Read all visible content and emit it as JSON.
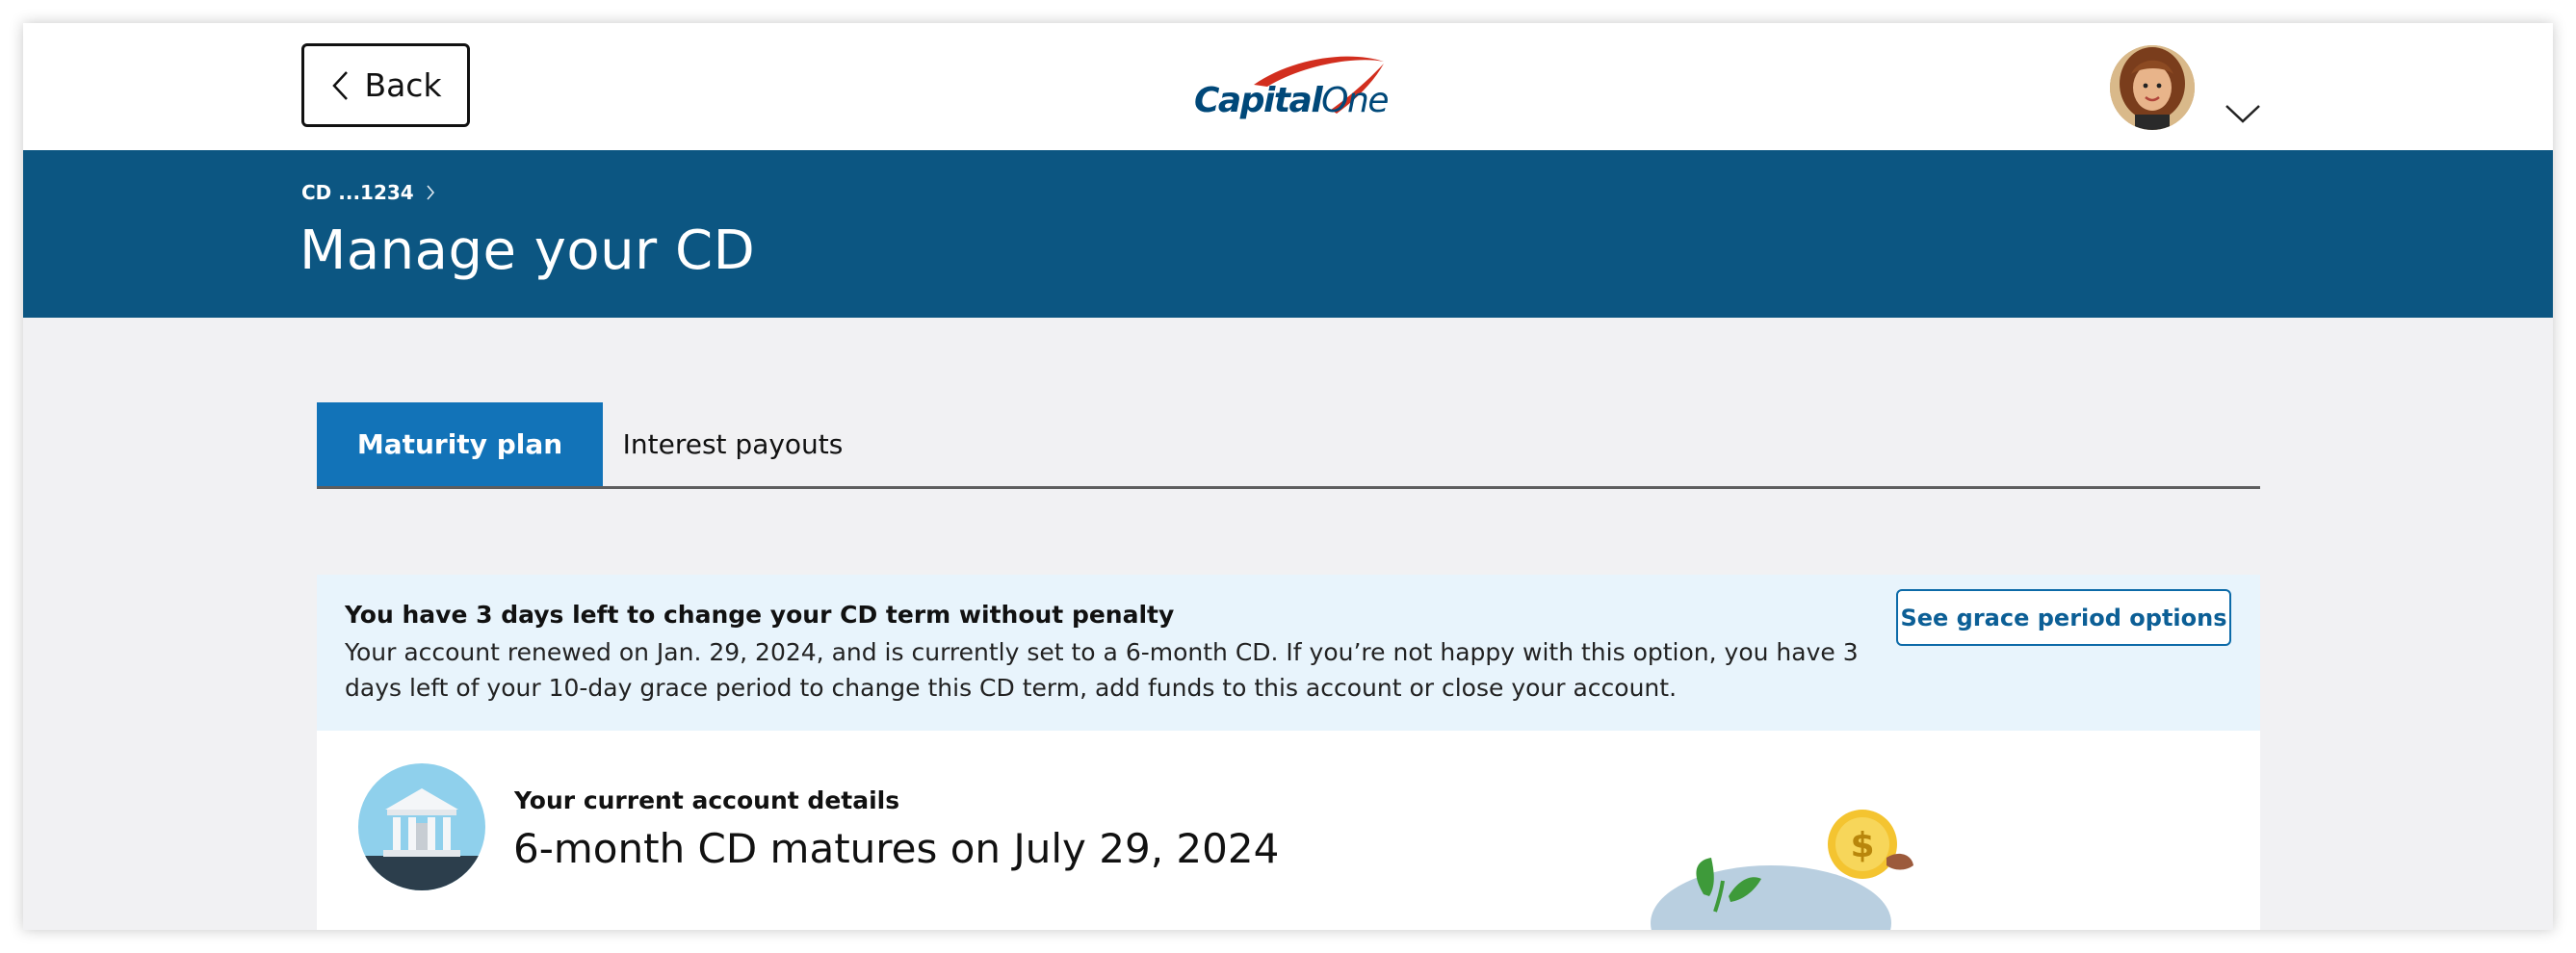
{
  "header": {
    "back_label": "Back",
    "logo_text_bold": "Capital",
    "logo_text_light": "One",
    "avatar_icon": "user-avatar",
    "menu_icon": "chevron-down-icon"
  },
  "banner": {
    "breadcrumb": "CD ...1234",
    "title": "Manage your CD",
    "background": "#0c5682"
  },
  "tabs": [
    {
      "label": "Maturity plan",
      "active": true
    },
    {
      "label": "Interest payouts",
      "active": false
    }
  ],
  "alert": {
    "title": "You have 3 days left to change your CD term without penalty",
    "body": "Your account renewed on Jan. 29, 2024, and is currently set to a 6-month CD. If you’re not happy with this option, you have 3 days left of your 10-day grace period to change this CD term, add funds to this account or close your account.",
    "button_label": "See grace period options"
  },
  "details": {
    "label": "Your current account details",
    "heading": "6-month CD matures on July 29, 2024",
    "icon": "bank-icon"
  },
  "colors": {
    "accent": "#1273b8",
    "brand_navy": "#004879",
    "brand_red": "#d22e1e",
    "alert_bg": "#e8f4fc"
  }
}
